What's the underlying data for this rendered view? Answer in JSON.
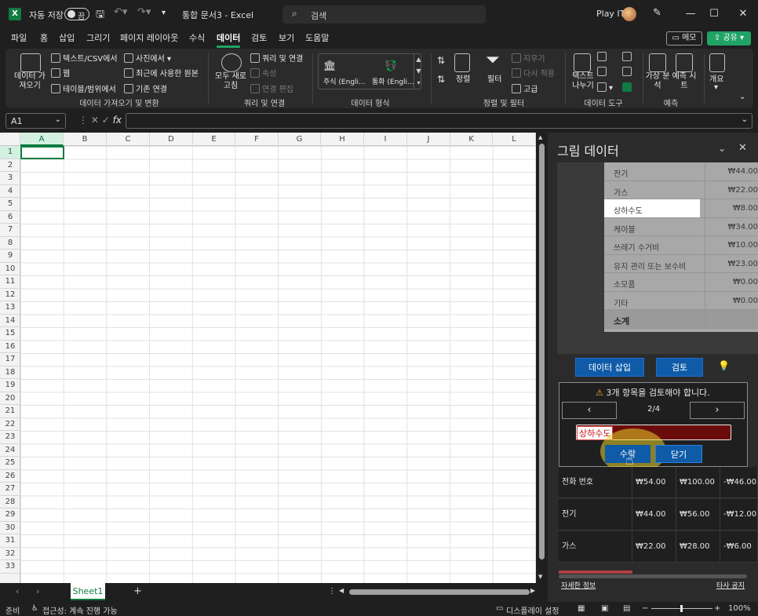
{
  "title_bar": {
    "app_icon": "X",
    "autosave_label": "자동 저장",
    "autosave_state": "끔",
    "doc_title": "통합 문서3 - Excel",
    "search_placeholder": "검색",
    "user_name": "Play IT"
  },
  "menu": {
    "tabs": [
      "파일",
      "홈",
      "삽입",
      "그리기",
      "페이지 레이아웃",
      "수식",
      "데이터",
      "검토",
      "보기",
      "도움말"
    ],
    "active": "데이터",
    "memo": "메모",
    "share": "공유"
  },
  "ribbon": {
    "get_data": {
      "big": "데이터 가져오기",
      "items": [
        "텍스트/CSV에서",
        "웹",
        "테이블/범위에서",
        "사진에서",
        "최근에 사용한 원본",
        "기존 연결"
      ],
      "label": "데이터 가져오기 및 변환"
    },
    "queries": {
      "big": "모두 새로 고침",
      "items": [
        "쿼리 및 연결",
        "속성",
        "연결 편집"
      ],
      "label": "쿼리 및 연결"
    },
    "types": {
      "items": [
        "주식 (Engli...",
        "통화 (Engli..."
      ],
      "label": "데이터 형식"
    },
    "sort": {
      "items": [
        "정렬",
        "필터",
        "지우기",
        "다시 적용",
        "고급"
      ],
      "label": "정렬 및 필터"
    },
    "tools": {
      "big": "텍스트 나누기",
      "label": "데이터 도구"
    },
    "forecast": {
      "items": [
        "가상 분석",
        "예측 시트"
      ],
      "label": "예측"
    },
    "outline": {
      "big": "개요"
    }
  },
  "formula_bar": {
    "name_box": "A1",
    "fx": "fx",
    "content": ""
  },
  "grid": {
    "columns": [
      "A",
      "B",
      "C",
      "D",
      "E",
      "F",
      "G",
      "H",
      "I",
      "J",
      "K",
      "L"
    ],
    "rows": [
      "1",
      "2",
      "3",
      "4",
      "5",
      "6",
      "7",
      "8",
      "9",
      "10",
      "11",
      "12",
      "13",
      "14",
      "15",
      "16",
      "17",
      "18",
      "19",
      "20",
      "21",
      "22",
      "23",
      "24",
      "25",
      "26",
      "27",
      "28",
      "29",
      "30",
      "31",
      "32",
      "33"
    ]
  },
  "sheets": {
    "tabs": [
      "Sheet1"
    ],
    "add": "+"
  },
  "status": {
    "ready": "준비",
    "accessibility": "접근성: 계속 진행 가능",
    "display": "디스플레이 설정",
    "zoom": "100%"
  },
  "pane": {
    "title": "그림 데이터",
    "image_rows": [
      {
        "name": "전기",
        "value": "₩44.00"
      },
      {
        "name": "가스",
        "value": "₩22.00"
      },
      {
        "name": "상하수도",
        "value": "₩8.00"
      },
      {
        "name": "케이블",
        "value": "₩34.00"
      },
      {
        "name": "쓰레기 수거비",
        "value": "₩10.00"
      },
      {
        "name": "유지 관리 또는 보수비",
        "value": "₩23.00"
      },
      {
        "name": "소모품",
        "value": "₩0.00"
      },
      {
        "name": "기타",
        "value": "₩0.00"
      },
      {
        "name": "소계",
        "value": ""
      }
    ],
    "insert_btn": "데이터 삽입",
    "review_btn": "검토",
    "review_msg": "3개 항목을 검토해야 합니다.",
    "prev": "‹",
    "next": "›",
    "counter": "2/4",
    "field_value": "상하수도",
    "accept": "수락",
    "close": "닫기",
    "table_rows": [
      [
        "전화 번호",
        "₩54.00",
        "₩100.00",
        "-₩46.00"
      ],
      [
        "전기",
        "₩44.00",
        "₩56.00",
        "-₩12.00"
      ],
      [
        "가스",
        "₩22.00",
        "₩28.00",
        "-₩6.00"
      ]
    ],
    "link_more": "자세한 정보",
    "link_privacy": "타사 공지"
  }
}
